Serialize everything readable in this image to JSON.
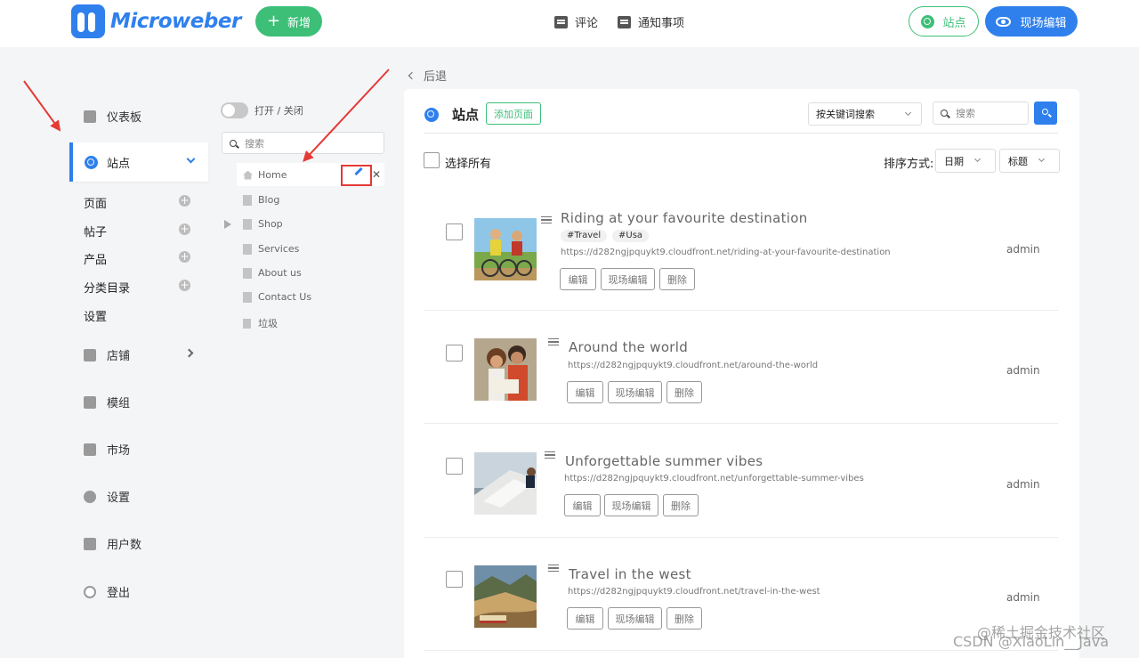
{
  "topbar": {
    "logo_text": "Microweber",
    "add_label": "新增",
    "nav": [
      {
        "label": "评论",
        "icon": "comment-icon"
      },
      {
        "label": "通知事项",
        "icon": "notification-icon"
      }
    ],
    "site_label": "站点",
    "live_edit_label": "现场编辑"
  },
  "sidebar": {
    "items": [
      {
        "label": "仪表板",
        "icon": "dashboard-icon"
      },
      {
        "label": "站点",
        "icon": "globe-icon",
        "active": true
      },
      {
        "label": "店铺",
        "icon": "shop-bag-icon"
      },
      {
        "label": "模组",
        "icon": "modules-icon"
      },
      {
        "label": "市场",
        "icon": "market-icon"
      },
      {
        "label": "设置",
        "icon": "settings-gear-icon"
      },
      {
        "label": "用户数",
        "icon": "users-icon"
      },
      {
        "label": "登出",
        "icon": "logout-icon"
      }
    ],
    "sub_items": [
      {
        "label": "页面"
      },
      {
        "label": "帖子"
      },
      {
        "label": "产品"
      },
      {
        "label": "分类目录"
      },
      {
        "label": "设置"
      }
    ]
  },
  "tree": {
    "toggle_label": "打开 / 关闭",
    "search_placeholder": "搜索",
    "items": [
      {
        "label": "Home",
        "icon": "home-icon"
      },
      {
        "label": "Blog",
        "icon": "blog-page-icon"
      },
      {
        "label": "Shop",
        "icon": "page-icon"
      },
      {
        "label": "Services",
        "icon": "page-icon"
      },
      {
        "label": "About us",
        "icon": "page-icon"
      },
      {
        "label": "Contact Us",
        "icon": "page-icon"
      },
      {
        "label": "垃圾",
        "icon": "trash-icon"
      }
    ]
  },
  "main": {
    "back_label": "后退",
    "title": "站点",
    "add_page_label": "添加页面",
    "keyword_select": "按关键词搜索",
    "search_placeholder": "搜索",
    "select_all_label": "选择所有",
    "sort_label": "排序方式:",
    "sort_date": "日期",
    "sort_title": "标题",
    "action_labels": {
      "edit": "编辑",
      "live_edit": "现场编辑",
      "delete": "删除"
    },
    "posts": [
      {
        "title": "Riding at your favourite destination",
        "tags": [
          "#Travel",
          "#Usa"
        ],
        "url": "https://d282ngjpquykt9.cloudfront.net/riding-at-your-favourite-destination",
        "author": "admin"
      },
      {
        "title": "Around the world",
        "tags": [],
        "url": "https://d282ngjpquykt9.cloudfront.net/around-the-world",
        "author": "admin"
      },
      {
        "title": "Unforgettable summer vibes",
        "tags": [],
        "url": "https://d282ngjpquykt9.cloudfront.net/unforgettable-summer-vibes",
        "author": "admin"
      },
      {
        "title": "Travel in the west",
        "tags": [],
        "url": "https://d282ngjpquykt9.cloudfront.net/travel-in-the-west",
        "author": "admin"
      }
    ]
  },
  "watermark": {
    "line1": "@稀土掘金技术社区",
    "line2": "CSDN @XiaoLin__Java"
  },
  "colors": {
    "accent_blue": "#2f80ed",
    "accent_green": "#3dbf78",
    "annotation_red": "#e53935"
  }
}
